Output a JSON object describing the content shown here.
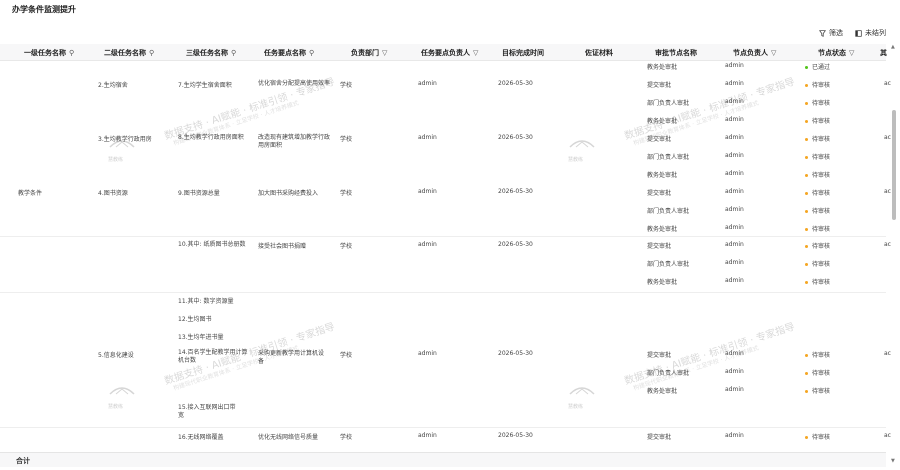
{
  "page": {
    "title": "办学条件监测提升"
  },
  "toolbar": {
    "filter_label": "筛选",
    "columns_label": "未结列"
  },
  "columns": [
    "一级任务名称",
    "二级任务名称",
    "三级任务名称",
    "任务要点名称",
    "负责部门",
    "任务要点负责人",
    "目标完成时间",
    "佐证材料",
    "审批节点名称",
    "节点负责人",
    "节点状态",
    "其"
  ],
  "watermark": {
    "main": "数据支持 · AI赋能 · 标准引领 · 专家指导",
    "sub": "构建现代职业教育体系 · 立足学校 · 人才培养模式",
    "logo_text": "慧教练"
  },
  "level1": "教学条件",
  "level2": [
    "2.生均宿舍",
    "3.生均教学行政用房",
    "4.图书资源",
    "5.信息化建设"
  ],
  "level3": [
    "7.生均学生宿舍面积",
    "8.生均教学行政用房面积",
    "9.图书资源总量",
    "10.其中: 纸质图书总册数",
    "11.其中: 数字资源量",
    "12.生均图书",
    "13.生均年进书量",
    "14.百名学生配教学用计算机台数",
    "15.接入互联网出口带宽",
    "16.无线网络覆盖"
  ],
  "points": [
    "优化宿舍分配提高使用效率",
    "改造现有建筑增加教学行政用房面积",
    "加大图书采购经费投入",
    "接受社会图书捐赠",
    "采购更新教学用计算机设备",
    "优化无线网络信号质量"
  ],
  "dept": "学校",
  "owner": "admin",
  "deadline": "2026-05-30",
  "approval": [
    "教务处审批",
    "提交审批",
    "部门负责人审批",
    "教务处审批"
  ],
  "node_owner": "admin",
  "status_done": "已通过",
  "status_pending": "待审核",
  "tail": "ac",
  "footer": {
    "label": "合计"
  },
  "colors": {
    "pending_dot": "#f5a623",
    "done_dot": "#52c41a"
  }
}
